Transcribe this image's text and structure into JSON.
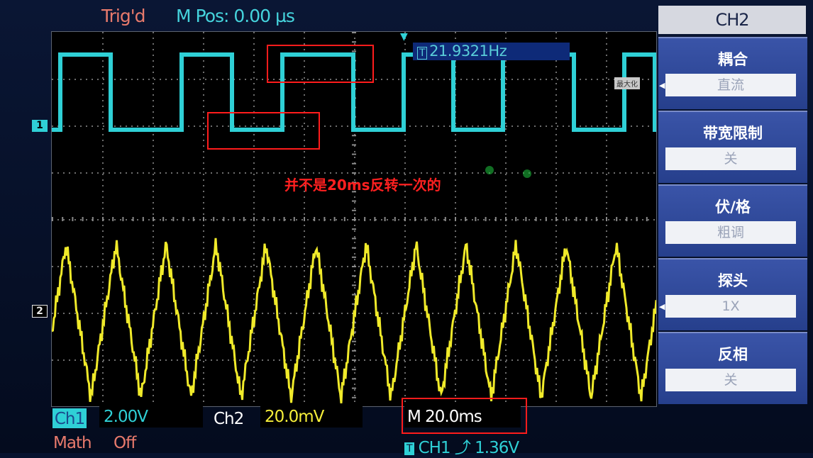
{
  "status": {
    "trigger_state": "Trig'd",
    "main_position": "M Pos: 0.00 µs"
  },
  "channel_markers": {
    "ch1": "1",
    "ch2": "2"
  },
  "trigger_position_glyph": "▼",
  "frequency": {
    "icon_text": "T",
    "value": "21.9321Hz"
  },
  "maximize_button": "最大化",
  "annotation": "并不是20ms反转一次的",
  "menu": {
    "title": "CH2",
    "items": [
      {
        "label": "耦合",
        "value": "直流"
      },
      {
        "label": "带宽限制",
        "value": "关"
      },
      {
        "label": "伏/格",
        "value": "粗调"
      },
      {
        "label": "探头",
        "value": "1X"
      },
      {
        "label": "反相",
        "value": "关"
      }
    ]
  },
  "bottom": {
    "ch1_tag": "Ch1",
    "ch1_scale": "2.00V",
    "ch2_tag": "Ch2",
    "ch2_scale": "20.0mV",
    "timebase": "M 20.0ms",
    "math_label": "Math",
    "math_state": "Off",
    "trigger_icon": "T",
    "trigger_source": "CH1 ⤴ 1.36V"
  },
  "colors": {
    "ch1_trace": "#2fd0d6",
    "ch2_trace": "#f0ea2a",
    "annotation_red": "#ff2020"
  }
}
